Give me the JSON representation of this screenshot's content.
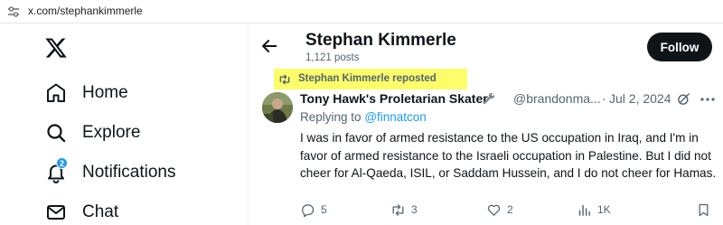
{
  "browser": {
    "url": "x.com/stephankimmerle"
  },
  "sidebar": {
    "logo_icon": "x-logo-icon",
    "items": [
      {
        "label": "Home",
        "icon": "home-icon"
      },
      {
        "label": "Explore",
        "icon": "search-icon"
      },
      {
        "label": "Notifications",
        "icon": "bell-icon",
        "badge": "2"
      },
      {
        "label": "Chat",
        "icon": "mail-icon"
      }
    ]
  },
  "header": {
    "name": "Stephan Kimmerle",
    "post_count": "1,121 posts",
    "follow_label": "Follow"
  },
  "repost": {
    "text": "Stephan Kimmerle reposted",
    "highlight_color": "#fdfd6a"
  },
  "tweet": {
    "author_name": "Tony Hawk's Proletarian Skater",
    "handle": "@brandonma...",
    "separator": "·",
    "date": "Jul 2, 2024",
    "reply_prefix": "Replying to",
    "reply_mention": "@finnatcon",
    "text": "I was in favor of armed resistance to the US occupation in Iraq, and I'm in favor of armed resistance to the Israeli occupation in Palestine. But I did not cheer for Al-Qaeda, ISIL, or Saddam Hussein, and I do not cheer for Hamas.",
    "actions": {
      "replies": "5",
      "reposts": "3",
      "likes": "2",
      "views": "1K"
    }
  },
  "colors": {
    "accent": "#1d9bf0",
    "text": "#0f1419",
    "secondary": "#536471"
  }
}
